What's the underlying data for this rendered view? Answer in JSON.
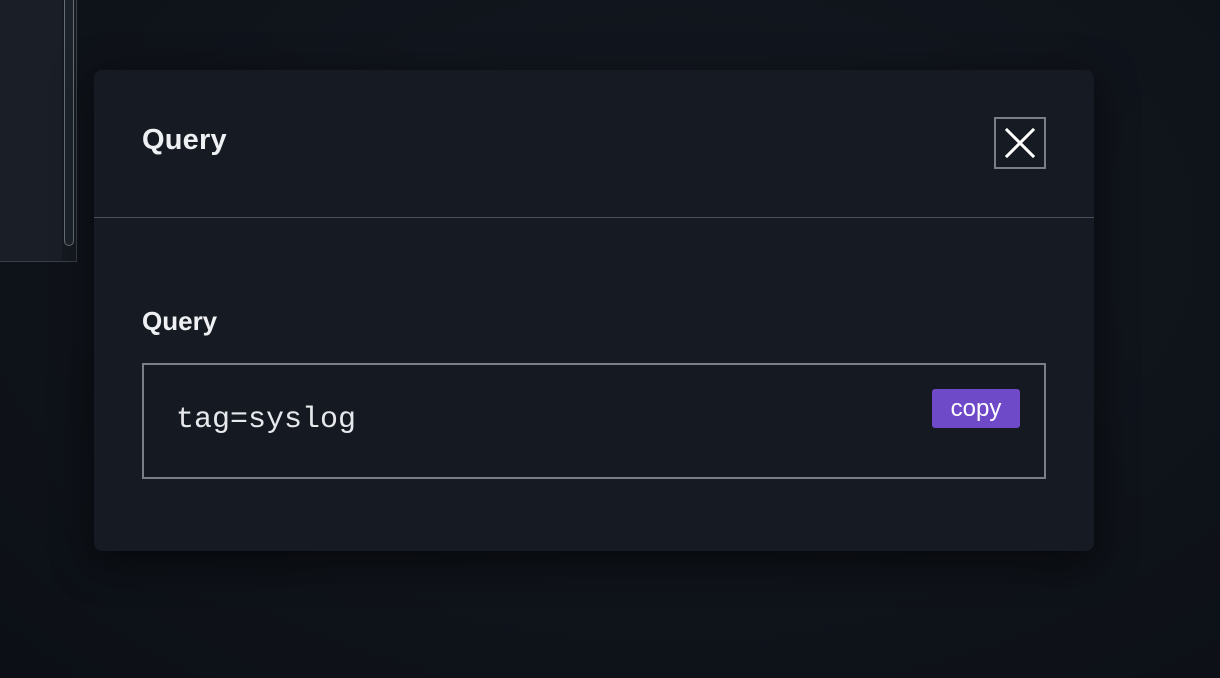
{
  "modal": {
    "title": "Query",
    "close_icon": "close-icon",
    "field_label": "Query",
    "query_value": "tag=syslog",
    "copy_label": "copy"
  },
  "colors": {
    "accent": "#6f4ac8",
    "background": "#0e1219",
    "modal_background": "#161b23"
  }
}
